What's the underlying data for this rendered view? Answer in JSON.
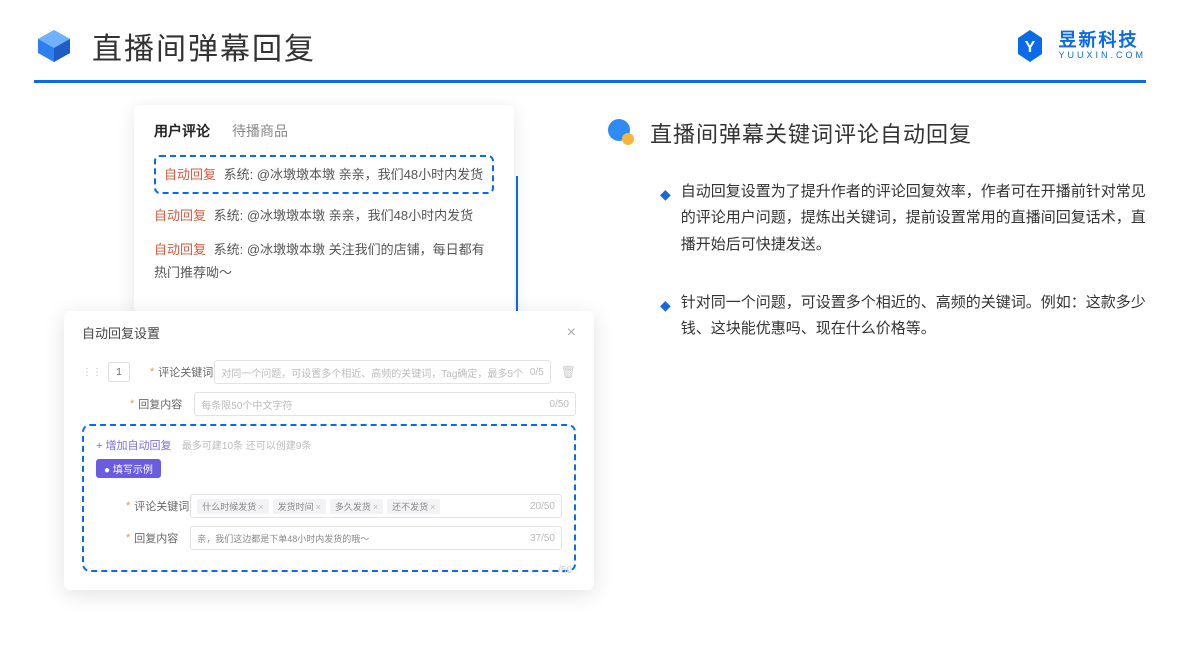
{
  "header": {
    "title": "直播间弹幕回复",
    "brand_cn": "昱新科技",
    "brand_en": "YUUXIN.COM"
  },
  "comment_panel": {
    "tab_active": "用户评论",
    "tab_inactive": "待播商品",
    "highlighted": {
      "label": "自动回复",
      "text": "系统: @冰墩墩本墩 亲亲，我们48小时内发货"
    },
    "item2": {
      "label": "自动回复",
      "text": "系统: @冰墩墩本墩 亲亲，我们48小时内发货"
    },
    "item3": {
      "label": "自动回复",
      "text": "系统: @冰墩墩本墩 关注我们的店铺，每日都有热门推荐呦～"
    }
  },
  "settings_modal": {
    "title": "自动回复设置",
    "order": "1",
    "row_keyword": {
      "label": "评论关键词",
      "placeholder": "对同一个问题，可设置多个相近、高频的关键词，Tag确定，最多5个",
      "counter": "0/5"
    },
    "row_content": {
      "label": "回复内容",
      "placeholder": "每条限50个中文字符",
      "counter": "0/50"
    },
    "add_link": "+ 增加自动回复",
    "add_hint": "最多可建10条 还可以创建9条",
    "example": {
      "badge": "● 填写示例",
      "kw_label": "评论关键词",
      "kw_tags": [
        "什么时候发货",
        "发货时间",
        "多久发货",
        "还不发货"
      ],
      "kw_counter": "20/50",
      "content_label": "回复内容",
      "content_text": "亲，我们这边都是下单48小时内发货的哦～",
      "content_counter": "37/50"
    },
    "side_counter": "/50"
  },
  "right": {
    "section_title": "直播间弹幕关键词评论自动回复",
    "point1": "自动回复设置为了提升作者的评论回复效率，作者可在开播前针对常见的评论用户问题，提炼出关键词，提前设置常用的直播间回复话术，直播开始后可快捷发送。",
    "point2": "针对同一个问题，可设置多个相近的、高频的关键词。例如：这款多少钱、这块能优惠吗、现在什么价格等。"
  }
}
